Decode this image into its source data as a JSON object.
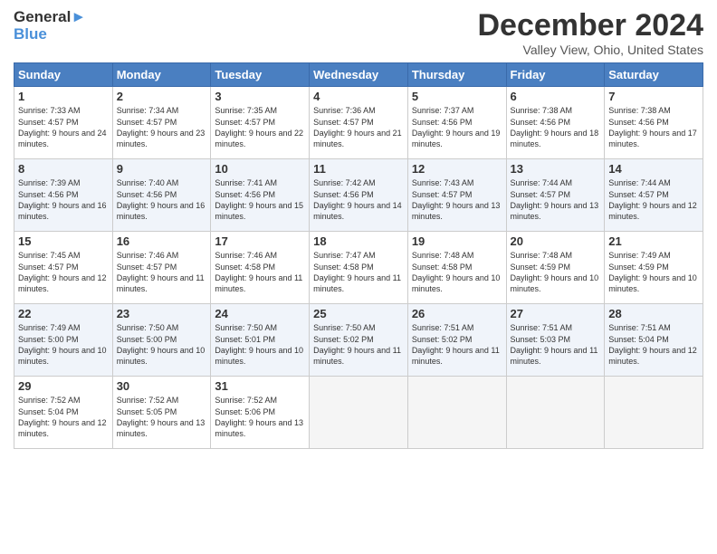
{
  "logo": {
    "line1": "General",
    "line2": "Blue"
  },
  "title": "December 2024",
  "location": "Valley View, Ohio, United States",
  "days_of_week": [
    "Sunday",
    "Monday",
    "Tuesday",
    "Wednesday",
    "Thursday",
    "Friday",
    "Saturday"
  ],
  "weeks": [
    [
      {
        "day": 1,
        "sunrise": "7:33 AM",
        "sunset": "4:57 PM",
        "daylight": "9 hours and 24 minutes."
      },
      {
        "day": 2,
        "sunrise": "7:34 AM",
        "sunset": "4:57 PM",
        "daylight": "9 hours and 23 minutes."
      },
      {
        "day": 3,
        "sunrise": "7:35 AM",
        "sunset": "4:57 PM",
        "daylight": "9 hours and 22 minutes."
      },
      {
        "day": 4,
        "sunrise": "7:36 AM",
        "sunset": "4:57 PM",
        "daylight": "9 hours and 21 minutes."
      },
      {
        "day": 5,
        "sunrise": "7:37 AM",
        "sunset": "4:56 PM",
        "daylight": "9 hours and 19 minutes."
      },
      {
        "day": 6,
        "sunrise": "7:38 AM",
        "sunset": "4:56 PM",
        "daylight": "9 hours and 18 minutes."
      },
      {
        "day": 7,
        "sunrise": "7:38 AM",
        "sunset": "4:56 PM",
        "daylight": "9 hours and 17 minutes."
      }
    ],
    [
      {
        "day": 8,
        "sunrise": "7:39 AM",
        "sunset": "4:56 PM",
        "daylight": "9 hours and 16 minutes."
      },
      {
        "day": 9,
        "sunrise": "7:40 AM",
        "sunset": "4:56 PM",
        "daylight": "9 hours and 16 minutes."
      },
      {
        "day": 10,
        "sunrise": "7:41 AM",
        "sunset": "4:56 PM",
        "daylight": "9 hours and 15 minutes."
      },
      {
        "day": 11,
        "sunrise": "7:42 AM",
        "sunset": "4:56 PM",
        "daylight": "9 hours and 14 minutes."
      },
      {
        "day": 12,
        "sunrise": "7:43 AM",
        "sunset": "4:57 PM",
        "daylight": "9 hours and 13 minutes."
      },
      {
        "day": 13,
        "sunrise": "7:44 AM",
        "sunset": "4:57 PM",
        "daylight": "9 hours and 13 minutes."
      },
      {
        "day": 14,
        "sunrise": "7:44 AM",
        "sunset": "4:57 PM",
        "daylight": "9 hours and 12 minutes."
      }
    ],
    [
      {
        "day": 15,
        "sunrise": "7:45 AM",
        "sunset": "4:57 PM",
        "daylight": "9 hours and 12 minutes."
      },
      {
        "day": 16,
        "sunrise": "7:46 AM",
        "sunset": "4:57 PM",
        "daylight": "9 hours and 11 minutes."
      },
      {
        "day": 17,
        "sunrise": "7:46 AM",
        "sunset": "4:58 PM",
        "daylight": "9 hours and 11 minutes."
      },
      {
        "day": 18,
        "sunrise": "7:47 AM",
        "sunset": "4:58 PM",
        "daylight": "9 hours and 11 minutes."
      },
      {
        "day": 19,
        "sunrise": "7:48 AM",
        "sunset": "4:58 PM",
        "daylight": "9 hours and 10 minutes."
      },
      {
        "day": 20,
        "sunrise": "7:48 AM",
        "sunset": "4:59 PM",
        "daylight": "9 hours and 10 minutes."
      },
      {
        "day": 21,
        "sunrise": "7:49 AM",
        "sunset": "4:59 PM",
        "daylight": "9 hours and 10 minutes."
      }
    ],
    [
      {
        "day": 22,
        "sunrise": "7:49 AM",
        "sunset": "5:00 PM",
        "daylight": "9 hours and 10 minutes."
      },
      {
        "day": 23,
        "sunrise": "7:50 AM",
        "sunset": "5:00 PM",
        "daylight": "9 hours and 10 minutes."
      },
      {
        "day": 24,
        "sunrise": "7:50 AM",
        "sunset": "5:01 PM",
        "daylight": "9 hours and 10 minutes."
      },
      {
        "day": 25,
        "sunrise": "7:50 AM",
        "sunset": "5:02 PM",
        "daylight": "9 hours and 11 minutes."
      },
      {
        "day": 26,
        "sunrise": "7:51 AM",
        "sunset": "5:02 PM",
        "daylight": "9 hours and 11 minutes."
      },
      {
        "day": 27,
        "sunrise": "7:51 AM",
        "sunset": "5:03 PM",
        "daylight": "9 hours and 11 minutes."
      },
      {
        "day": 28,
        "sunrise": "7:51 AM",
        "sunset": "5:04 PM",
        "daylight": "9 hours and 12 minutes."
      }
    ],
    [
      {
        "day": 29,
        "sunrise": "7:52 AM",
        "sunset": "5:04 PM",
        "daylight": "9 hours and 12 minutes."
      },
      {
        "day": 30,
        "sunrise": "7:52 AM",
        "sunset": "5:05 PM",
        "daylight": "9 hours and 13 minutes."
      },
      {
        "day": 31,
        "sunrise": "7:52 AM",
        "sunset": "5:06 PM",
        "daylight": "9 hours and 13 minutes."
      },
      null,
      null,
      null,
      null
    ]
  ]
}
